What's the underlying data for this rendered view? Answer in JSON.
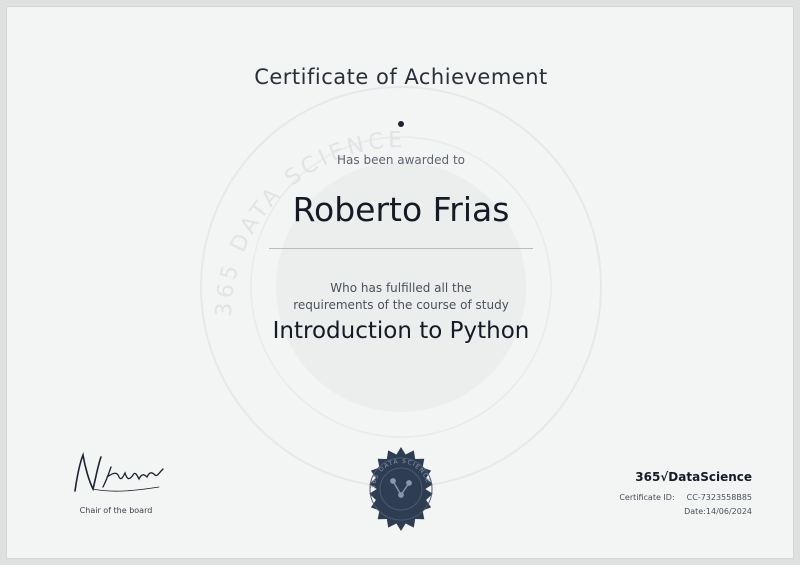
{
  "certificate": {
    "title": "Certificate of Achievement",
    "awarded_text": "Has been awarded to",
    "recipient_name": "Roberto Frias",
    "fulfilled_line1": "Who has fulfilled all the",
    "fulfilled_line2": "requirements of the course of study",
    "course_name": "Introduction to Python"
  },
  "watermark": {
    "ring_text": "365 DATA SCIENCE"
  },
  "signature": {
    "role": "Chair of the board"
  },
  "issuer": {
    "brand": "365√DataScience",
    "id_label": "Certificate ID:",
    "id_value": "CC-7323558B85",
    "date_label": "Date:",
    "date_value": "14/06/2024"
  },
  "seal": {
    "ring_text": "365 DATA SCIENCE"
  },
  "colors": {
    "ink": "#141a26",
    "seal": "#2f3d52",
    "paper": "#f3f4f4"
  }
}
